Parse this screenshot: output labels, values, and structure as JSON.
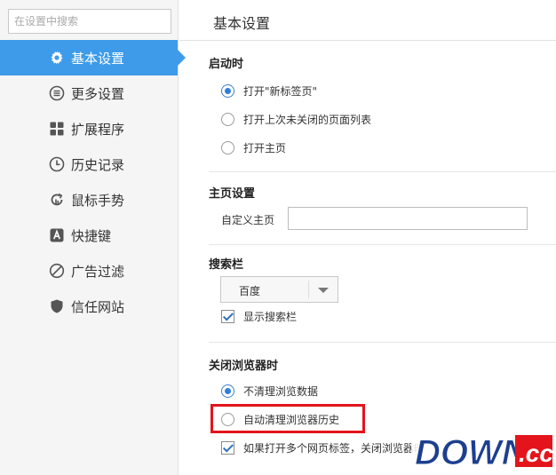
{
  "sidebar": {
    "search_placeholder": "在设置中搜索",
    "items": [
      {
        "label": "基本设置",
        "icon": "gear-icon",
        "active": true
      },
      {
        "label": "更多设置",
        "icon": "list-icon"
      },
      {
        "label": "扩展程序",
        "icon": "grid-icon"
      },
      {
        "label": "历史记录",
        "icon": "clock-icon"
      },
      {
        "label": "鼠标手势",
        "icon": "gesture-icon"
      },
      {
        "label": "快捷键",
        "icon": "keyboard-a-icon"
      },
      {
        "label": "广告过滤",
        "icon": "block-icon"
      },
      {
        "label": "信任网站",
        "icon": "shield-icon"
      }
    ]
  },
  "main": {
    "title": "基本设置",
    "startup": {
      "title": "启动时",
      "options": [
        "打开\"新标签页\"",
        "打开上次未关闭的页面列表",
        "打开主页"
      ],
      "selected_index": 0
    },
    "homepage": {
      "title": "主页设置",
      "field_label": "自定义主页",
      "value": ""
    },
    "searchbar": {
      "title": "搜索栏",
      "engine": "百度",
      "show_label": "显示搜索栏",
      "show_checked": true
    },
    "on_close": {
      "title": "关闭浏览器时",
      "options": [
        "不清理浏览数据",
        "自动清理浏览器历史"
      ],
      "selected_index": 0,
      "confirm_label": "如果打开多个网页标签，关闭浏览器时",
      "confirm_checked": true
    }
  },
  "colors": {
    "accent": "#3d9bea",
    "highlight": "#e3141b",
    "watermark_blue": "#1d3f8f"
  },
  "watermark": {
    "text": "DOWN",
    "suffix": ".cc"
  }
}
